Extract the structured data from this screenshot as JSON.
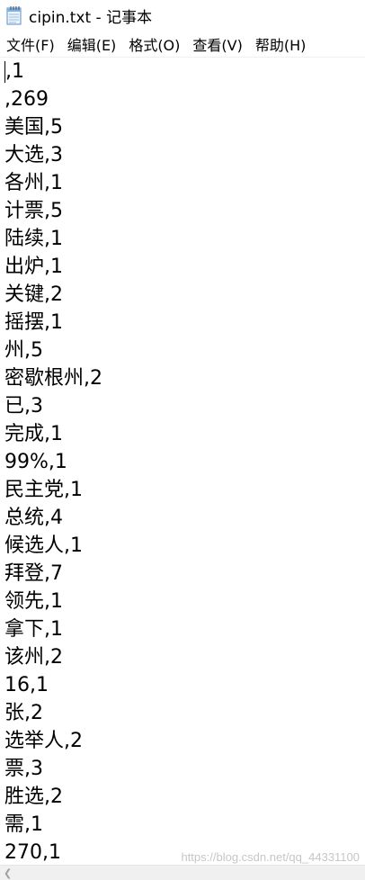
{
  "window": {
    "title": "cipin.txt - 记事本"
  },
  "menu": {
    "items": [
      {
        "label": "文件(F)"
      },
      {
        "label": "编辑(E)"
      },
      {
        "label": "格式(O)"
      },
      {
        "label": "查看(V)"
      },
      {
        "label": "帮助(H)"
      }
    ]
  },
  "editor": {
    "lines": [
      ",1",
      " ,269",
      "美国,5",
      "大选,3",
      "各州,1",
      "计票,5",
      "陆续,1",
      "出炉,1",
      "关键,2",
      "摇摆,1",
      "州,5",
      "密歇根州,2",
      "已,3",
      "完成,1",
      "99%,1",
      "民主党,1",
      "总统,4",
      "候选人,1",
      "拜登,7",
      "领先,1",
      "拿下,1",
      "该州,2",
      "16,1",
      "张,2",
      "选举人,2",
      "票,3",
      "胜选,2",
      "需,1",
      "270,1"
    ]
  },
  "watermark": "https://blog.csdn.net/qq_44331100",
  "icons": {
    "app": "notepad-icon",
    "scroll_left": "scroll-left-arrow-icon"
  }
}
